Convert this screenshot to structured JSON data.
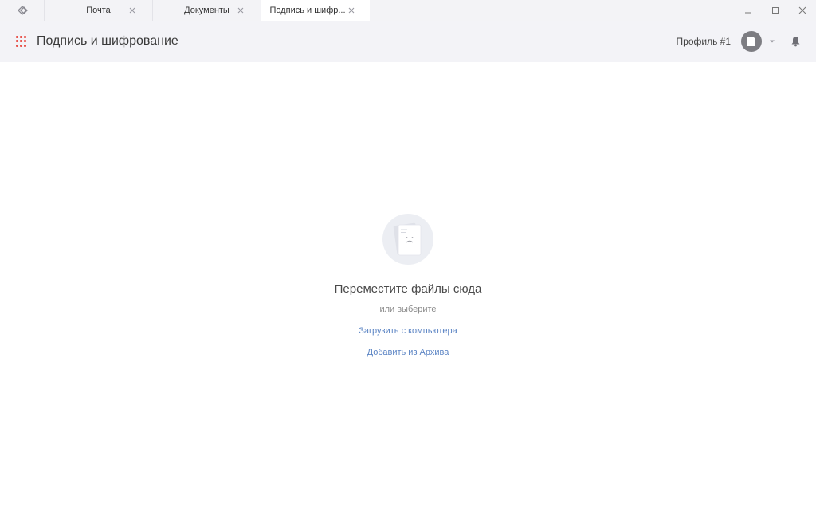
{
  "titlebar": {
    "tabs": [
      {
        "label": "Почта",
        "active": false
      },
      {
        "label": "Документы",
        "active": false
      },
      {
        "label": "Подпись и шифр...",
        "active": true
      }
    ],
    "icons": {
      "logo": "app-logo-icon",
      "close": "close-icon",
      "minimize": "minimize-icon",
      "maximize": "maximize-icon"
    }
  },
  "header": {
    "title": "Подпись и шифрование",
    "profile_name": "Профиль #1",
    "accent_color": "#e8554e",
    "icons": {
      "apps": "apps-grid-icon",
      "avatar": "document-avatar-icon",
      "caret": "chevron-down-icon",
      "notifications": "bell-icon"
    }
  },
  "dropzone": {
    "title": "Переместите файлы сюда",
    "subtitle": "или выберите",
    "upload_link": "Загрузить с компьютера",
    "archive_link": "Добавить из Архива",
    "link_color": "#5b84c4",
    "illustration": "sad-document-icon"
  }
}
